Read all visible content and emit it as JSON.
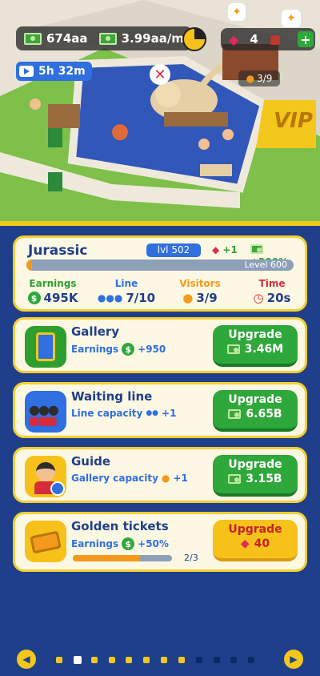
{
  "hud": {
    "cash": "674aa",
    "income": "3.99aa/m",
    "gems": "4",
    "boost_timer": "5h 32m",
    "plus": "+"
  },
  "room": {
    "visitors_badge": "3/9",
    "vip_label": "VIP",
    "name": "Jurassic",
    "level": "lvl 502",
    "gem_bonus": "+1",
    "cash_bonus": "+200%",
    "next_level": "Level 600",
    "level_progress": 0.02,
    "stats": [
      {
        "label": "Earnings",
        "value": "495K",
        "color": "#2e9e2e"
      },
      {
        "label": "Line",
        "value": "7/10",
        "color": "#2f6fe0"
      },
      {
        "label": "Visitors",
        "value": "3/9",
        "color": "#f39a1c"
      },
      {
        "label": "Time",
        "value": "20s",
        "color": "#d62b3b"
      }
    ]
  },
  "upgrades": [
    {
      "title": "Gallery",
      "sub_label": "Earnings",
      "sub_value": "+950",
      "button": "Upgrade",
      "cost": "3.46M"
    },
    {
      "title": "Waiting line",
      "sub_label": "Line capacity",
      "sub_value": "+1",
      "button": "Upgrade",
      "cost": "6.65B"
    },
    {
      "title": "Guide",
      "sub_label": "Gallery capacity",
      "sub_value": "+1",
      "button": "Upgrade",
      "cost": "3.15B"
    },
    {
      "title": "Golden tickets",
      "sub_label": "Earnings",
      "sub_value": "+50%",
      "progress_text": "2/3",
      "progress": 0.67,
      "button": "Upgrade",
      "cost": "40"
    }
  ],
  "pager": {
    "count": 12,
    "active": 1
  },
  "colors": {
    "accent": "#f3c71b",
    "panel_bg": "#1f3f8a",
    "green": "#2ea83a"
  }
}
